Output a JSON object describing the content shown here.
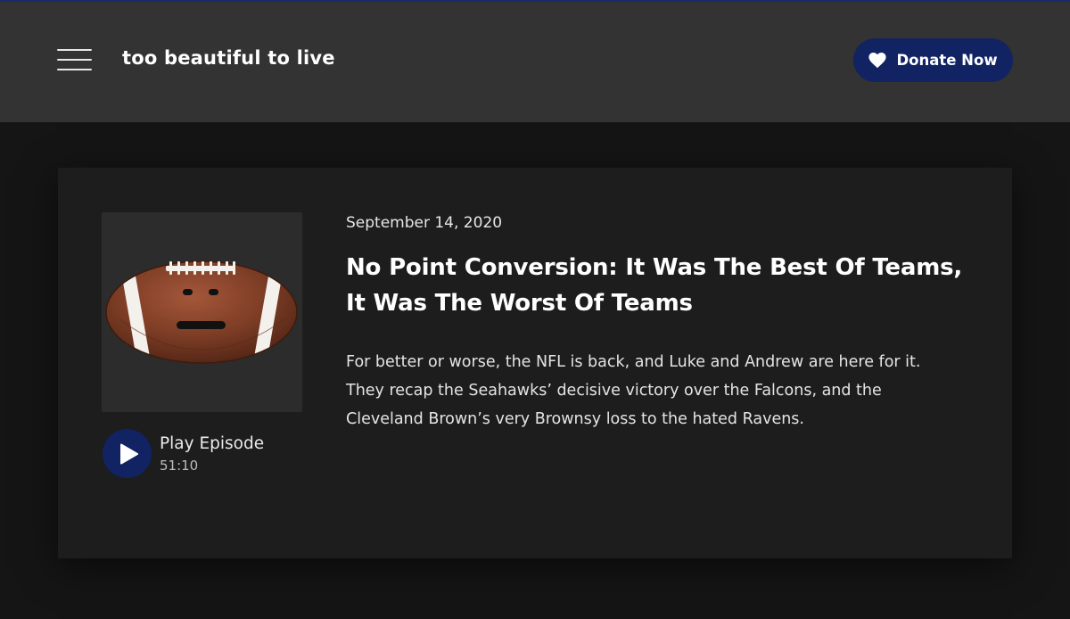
{
  "header": {
    "site_title": "too beautiful to live",
    "menu_icon": "hamburger-menu-icon",
    "donate": {
      "label": "Donate Now",
      "icon": "heart-icon",
      "background": "#112362"
    }
  },
  "episode": {
    "date": "September 14, 2020",
    "title": "No Point Conversion: It Was The Best Of Teams, It Was The Worst Of Teams",
    "description": "For better or worse, the NFL is back, and Luke and Andrew are here for it. They recap the Seahawks’ decisive victory over the Falcons, and the Cleveland Brown’s very Brownsy loss to the hated Ravens.",
    "artwork_icon": "football-face-icon",
    "play": {
      "label": "Play Episode",
      "duration": "51:10",
      "icon": "play-icon"
    }
  },
  "colors": {
    "accent": "#112362",
    "header_bg": "#333333",
    "card_bg": "#1d1d1d",
    "page_bg": "#151515"
  }
}
